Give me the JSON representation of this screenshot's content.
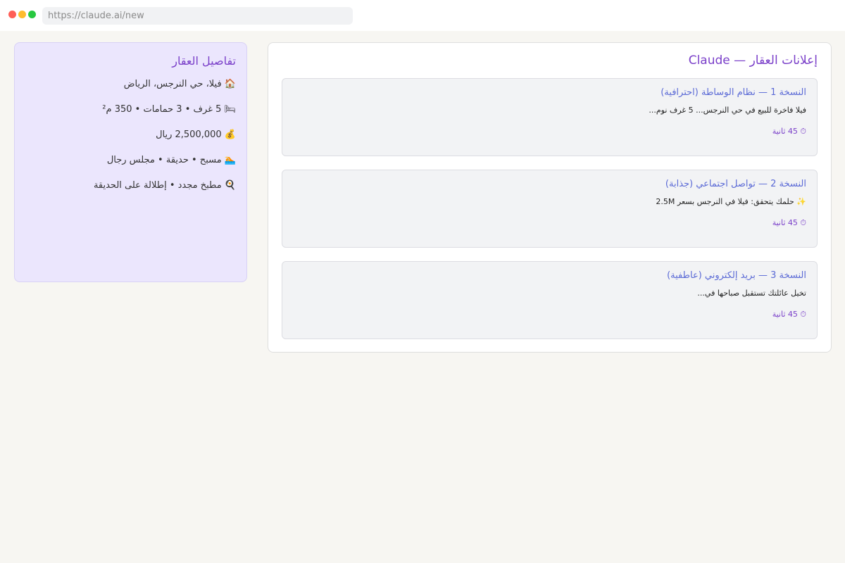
{
  "browser": {
    "url": "https://claude.ai/new"
  },
  "details_panel": {
    "title": "تفاصيل العقار",
    "rows": [
      "🏠 فيلا، حي النرجس، الرياض",
      "🛏 5 غرف • 3 حمامات • 350 م²",
      "💰 2,500,000 ريال",
      "🏊 مسبح • حديقة • مجلس رجال",
      "🍳 مطبخ مجدد • إطلالة على الحديقة"
    ]
  },
  "main_panel": {
    "title": "إعلانات العقار — Claude",
    "versions": [
      {
        "title": "النسخة 1 — نظام الوساطة (احترافية)",
        "body": "فيلا فاخرة للبيع في حي النرجس... 5 غرف نوم...",
        "meta": "⏱ 45 ثانية"
      },
      {
        "title": "النسخة 2 — تواصل اجتماعي (جذابة)",
        "body": "✨ حلمك يتحقق: فيلا في النرجس بسعر 2.5M",
        "meta": "⏱ 45 ثانية"
      },
      {
        "title": "النسخة 3 — بريد إلكتروني (عاطفية)",
        "body": "تخيل عائلتك تستقبل صباحها في...",
        "meta": "⏱ 45 ثانية"
      }
    ]
  }
}
